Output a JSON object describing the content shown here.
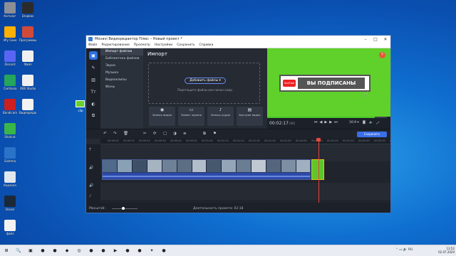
{
  "desktop": {
    "icons_left": [
      {
        "label": "Каталог",
        "color": "#8c8f95"
      },
      {
        "label": "4Ру Скин",
        "color": "#ffb000"
      },
      {
        "label": "Discord",
        "color": "#5865f2"
      },
      {
        "label": "Camtasia",
        "color": "#26a65b"
      },
      {
        "label": "Bandicam",
        "color": "#cc1f1f"
      },
      {
        "label": "Shotcut",
        "color": "#39b54a"
      },
      {
        "label": "Sistema",
        "color": "#2b73c9"
      },
      {
        "label": "Корзина",
        "color": "#dfe6ee"
      },
      {
        "label": "Steam",
        "color": "#1b2838"
      },
      {
        "label": "файл",
        "color": "#f2f2f2"
      }
    ],
    "icons_right": [
      {
        "label": "Dropbox",
        "color": "#2b2b2b"
      },
      {
        "label": "Программы",
        "color": "#d04a3a"
      },
      {
        "label": "Файл",
        "color": "#f0f0f0"
      },
      {
        "label": "OBS Studio",
        "color": "#f0f0f0"
      },
      {
        "label": "Видеоредактор",
        "color": "#f2f2f2"
      }
    ],
    "green_square_label": "clip"
  },
  "window": {
    "title": "Movavi Видеоредактор Плюс – Новый проект *",
    "controls": [
      "–",
      "□",
      "✕"
    ],
    "menu": [
      "Файл",
      "Редактирование",
      "Просмотр",
      "Настройки",
      "Сохранить",
      "Справка"
    ]
  },
  "rail": [
    "▣",
    "✎",
    "▥",
    "Tт",
    "◐",
    "⧉"
  ],
  "import": {
    "title": "Импорт",
    "nav": [
      "Импорт файлов",
      "Библиотека файлов",
      "Звуки",
      "Музыка",
      "Видеоклипы",
      "Фоны"
    ],
    "add_button": "Добавить файлы ▾",
    "hint": "Перетащите файлы или папки сюда",
    "actions": [
      {
        "icon": "◉",
        "label": "Запись видео"
      },
      {
        "icon": "▭",
        "label": "Захват экрана"
      },
      {
        "icon": "♪",
        "label": "Запись аудио"
      },
      {
        "icon": "▤",
        "label": "Быстрое видео"
      }
    ]
  },
  "preview": {
    "badge_logo": "YouTube",
    "badge_text": "ВЫ ПОДПИСАНЫ",
    "help": "?",
    "time": "00:02:17",
    "time_ms": ".000",
    "aspect": "16:9 ▾",
    "progress": 0.9,
    "bg": "#60d12a"
  },
  "toolbar": {
    "icons": [
      "↶",
      "↷",
      "🗑",
      "✂",
      "⟳",
      "▢",
      "◑",
      "≡",
      "⧉",
      "⚑"
    ],
    "save": "Сохранить"
  },
  "ruler": [
    "00:00:00",
    "00:00:10",
    "00:00:20",
    "00:00:30",
    "00:00:40",
    "00:00:50",
    "00:01:00",
    "00:01:10",
    "00:01:20",
    "00:01:30",
    "00:01:40",
    "00:01:50",
    "00:02:00",
    "00:02:10",
    "00:02:20",
    "00:02:30",
    "00:02:40",
    "00:02:50",
    "00:03:00"
  ],
  "tracks": {
    "icons": [
      "T",
      "🔊",
      "🔊",
      "♪"
    ]
  },
  "bottom": {
    "zoom_label": "Масштаб:",
    "duration": "Длительность проекта: 02:18",
    "zoom": 0.45
  },
  "taskbar": {
    "icons": [
      "⊞",
      "🔍",
      "▣",
      "●",
      "●",
      "◆",
      "◎",
      "●",
      "●",
      "▶",
      "●",
      "●",
      "✦",
      "●"
    ],
    "tray": "⌃ ▭ 🔊 RU",
    "time": "13:52",
    "date": "02.07.2020"
  }
}
